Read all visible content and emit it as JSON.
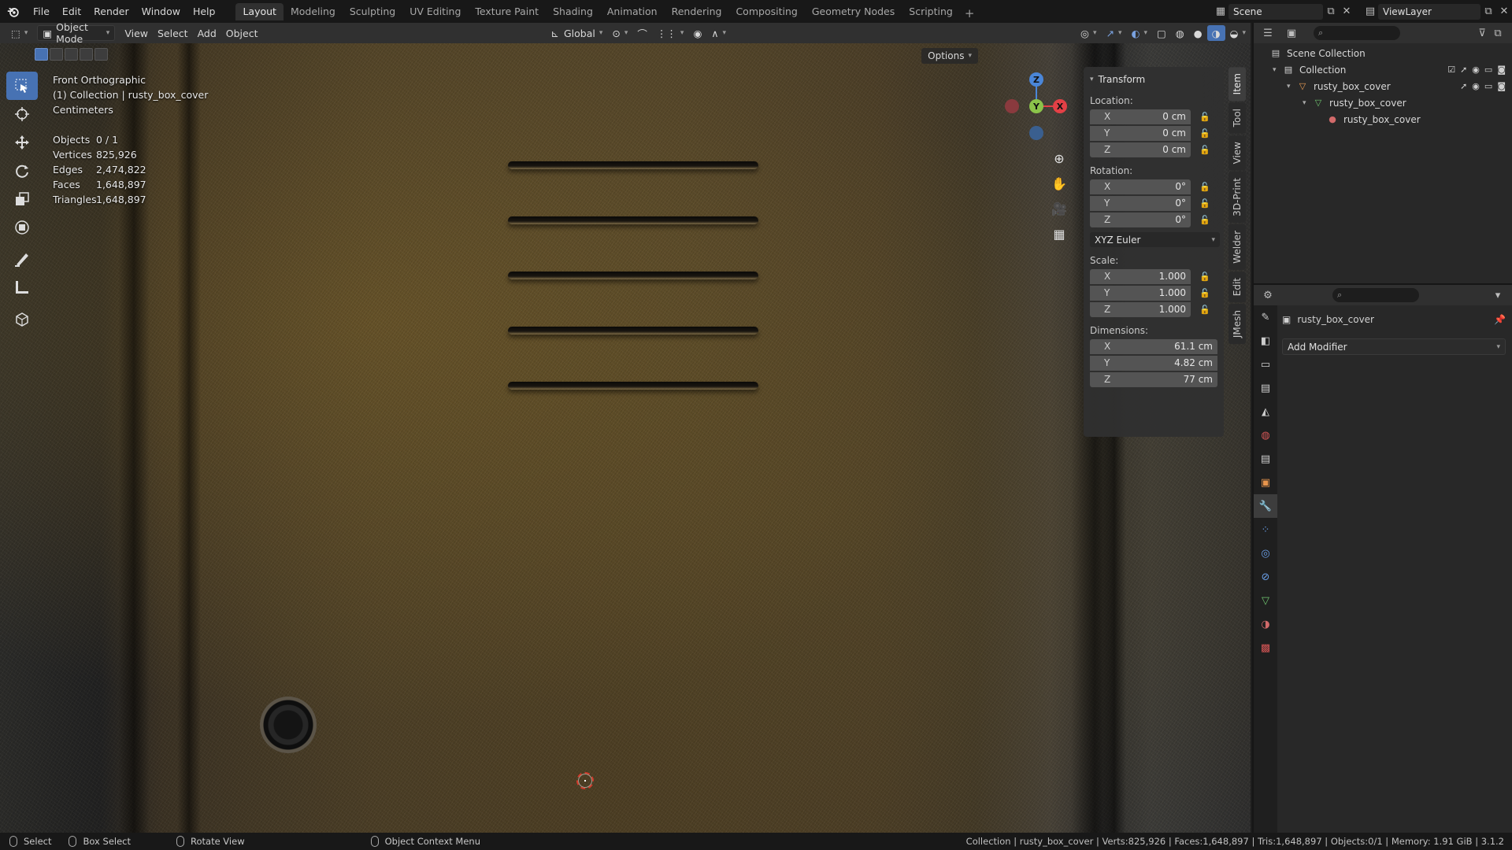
{
  "menubar": {
    "items": [
      "File",
      "Edit",
      "Render",
      "Window",
      "Help"
    ],
    "workspace_tabs": [
      "Layout",
      "Modeling",
      "Sculpting",
      "UV Editing",
      "Texture Paint",
      "Shading",
      "Animation",
      "Rendering",
      "Compositing",
      "Geometry Nodes",
      "Scripting"
    ],
    "active_tab": "Layout",
    "scene_name": "Scene",
    "view_layer": "ViewLayer"
  },
  "viewport_header": {
    "mode": "Object Mode",
    "menus": [
      "View",
      "Select",
      "Add",
      "Object"
    ],
    "transform_orientation": "Global",
    "options_label": "Options"
  },
  "viewport": {
    "view_name": "Front Orthographic",
    "collection_line": "(1) Collection | rusty_box_cover",
    "units": "Centimeters",
    "stats": [
      {
        "label": "Objects",
        "value": "0 / 1"
      },
      {
        "label": "Vertices",
        "value": "825,926"
      },
      {
        "label": "Edges",
        "value": "2,474,822"
      },
      {
        "label": "Faces",
        "value": "1,648,897"
      },
      {
        "label": "Triangles",
        "value": "1,648,897"
      }
    ],
    "gizmo_axes": {
      "x": "X",
      "y": "Y",
      "z": "Z"
    }
  },
  "npanel": {
    "section": "Transform",
    "location_label": "Location:",
    "location": [
      {
        "axis": "X",
        "value": "0 cm"
      },
      {
        "axis": "Y",
        "value": "0 cm"
      },
      {
        "axis": "Z",
        "value": "0 cm"
      }
    ],
    "rotation_label": "Rotation:",
    "rotation": [
      {
        "axis": "X",
        "value": "0°"
      },
      {
        "axis": "Y",
        "value": "0°"
      },
      {
        "axis": "Z",
        "value": "0°"
      }
    ],
    "rotation_mode": "XYZ Euler",
    "scale_label": "Scale:",
    "scale": [
      {
        "axis": "X",
        "value": "1.000"
      },
      {
        "axis": "Y",
        "value": "1.000"
      },
      {
        "axis": "Z",
        "value": "1.000"
      }
    ],
    "dimensions_label": "Dimensions:",
    "dimensions": [
      {
        "axis": "X",
        "value": "61.1 cm"
      },
      {
        "axis": "Y",
        "value": "4.82 cm"
      },
      {
        "axis": "Z",
        "value": "77 cm"
      }
    ],
    "tabs": [
      "Item",
      "Tool",
      "View",
      "3D-Print",
      "Welder",
      "Edit",
      "JMesh"
    ],
    "active_tab": "Item"
  },
  "outliner": {
    "rows": [
      {
        "label": "Scene Collection",
        "level": 0,
        "icon": "scene-collection-icon"
      },
      {
        "label": "Collection",
        "level": 1,
        "icon": "collection-icon"
      },
      {
        "label": "rusty_box_cover",
        "level": 2,
        "icon": "mesh-object-icon"
      },
      {
        "label": "rusty_box_cover",
        "level": 3,
        "icon": "mesh-data-icon"
      },
      {
        "label": "rusty_box_cover",
        "level": 4,
        "icon": "material-icon"
      }
    ]
  },
  "properties": {
    "object_name": "rusty_box_cover",
    "add_modifier_label": "Add Modifier"
  },
  "statusbar": {
    "left": [
      {
        "icon": "mouse-left-icon",
        "label": "Select"
      },
      {
        "icon": "mouse-left-icon",
        "label": "Box Select"
      },
      {
        "icon": "mouse-middle-icon",
        "label": "Rotate View"
      },
      {
        "icon": "mouse-right-icon",
        "label": "Object Context Menu"
      }
    ],
    "right_text": "Collection | rusty_box_cover | Verts:825,926 | Faces:1,648,897 | Tris:1,648,897 | Objects:0/1 | Memory: 1.91 GiB | 3.1.2"
  },
  "colors": {
    "accent": "#4772b3",
    "axis_x": "#e44046",
    "axis_y": "#8bc34a",
    "axis_z": "#4a86d8"
  }
}
